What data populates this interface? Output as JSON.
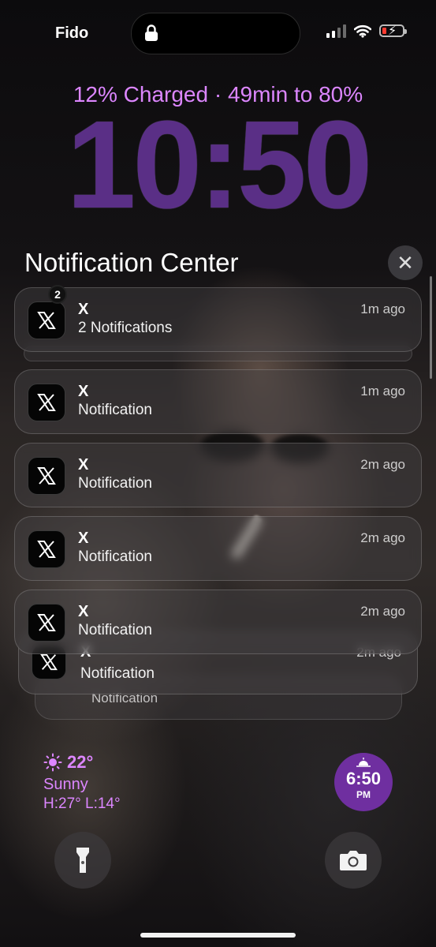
{
  "status_bar": {
    "carrier": "Fido",
    "icons": [
      "lock-icon",
      "cellular-signal-icon",
      "wifi-icon",
      "battery-charging-icon"
    ]
  },
  "lock_screen": {
    "charge_status": "12% Charged · 49min to 80%",
    "time": "10:50"
  },
  "notification_center": {
    "title": "Notification Center",
    "close_label": "✕",
    "groups": [
      {
        "app": "X",
        "body": "2 Notifications",
        "time": "1m ago",
        "badge": "2"
      },
      {
        "app": "X",
        "body": "Notification",
        "time": "1m ago"
      },
      {
        "app": "X",
        "body": "Notification",
        "time": "2m ago"
      },
      {
        "app": "X",
        "body": "Notification",
        "time": "2m ago"
      },
      {
        "app": "X",
        "body": "Notification",
        "time": "2m ago"
      }
    ],
    "stacked": [
      {
        "app": "X",
        "body": "Notification",
        "time": "2m ago"
      },
      {
        "app": "",
        "body": "Notification",
        "time": ""
      }
    ]
  },
  "widgets": {
    "weather": {
      "temp": "22°",
      "condition": "Sunny",
      "high_low": "H:27° L:14°"
    },
    "sunset": {
      "time": "6:50",
      "period": "PM"
    }
  },
  "colors": {
    "accent": "#dc86ff",
    "clock": "#5a2f86",
    "sunset_bg": "#6f2fa0"
  }
}
